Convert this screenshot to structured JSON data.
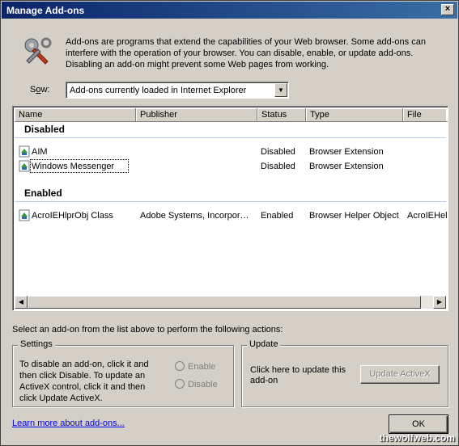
{
  "window": {
    "title": "Manage Add-ons",
    "close_glyph": "×"
  },
  "intro": "Add-ons are programs that extend the capabilities of your Web browser. Some add-ons can interfere with the operation of your browser. You can disable, enable, or update add-ons. Disabling an add-on might prevent some Web pages from working.",
  "show": {
    "label": "Show:",
    "label_underline": "o",
    "value": "Add-ons currently loaded in Internet Explorer"
  },
  "list": {
    "columns": [
      "Name",
      "Publisher",
      "Status",
      "Type",
      "File"
    ],
    "groups": [
      {
        "title": "Disabled",
        "rows": [
          {
            "name": "AIM",
            "publisher": "",
            "status": "Disabled",
            "type": "Browser Extension",
            "file": ""
          },
          {
            "name": "Windows Messenger",
            "publisher": "",
            "status": "Disabled",
            "type": "Browser Extension",
            "file": ""
          }
        ]
      },
      {
        "title": "Enabled",
        "rows": [
          {
            "name": "AcroIEHlprObj Class",
            "publisher": "Adobe Systems, Incorpor…",
            "status": "Enabled",
            "type": "Browser Helper Object",
            "file": "AcroIEHelp"
          }
        ]
      }
    ]
  },
  "actions_prompt": "Select an add-on from the list above to perform the following actions:",
  "settings": {
    "legend": "Settings",
    "text": "To disable an add-on, click it and then click Disable. To update an ActiveX control, click it and then click Update ActiveX.",
    "enable_label": "Enable",
    "disable_label": "Disable"
  },
  "update": {
    "legend": "Update",
    "text": "Click here to update this add-on",
    "button_label": "Update ActiveX"
  },
  "learn_more": "Learn more about add-ons...",
  "ok_label": "OK",
  "watermark": "thewolfweb.com",
  "colors": {
    "titlebar_start": "#0a246a",
    "titlebar_end": "#3a6ea5",
    "window_bg": "#d4d0c8",
    "link": "#0000ee"
  },
  "icons": [
    "tools-icon",
    "addon-icon",
    "close-icon",
    "dropdown-arrow-icon",
    "scroll-left-icon",
    "scroll-right-icon"
  ]
}
